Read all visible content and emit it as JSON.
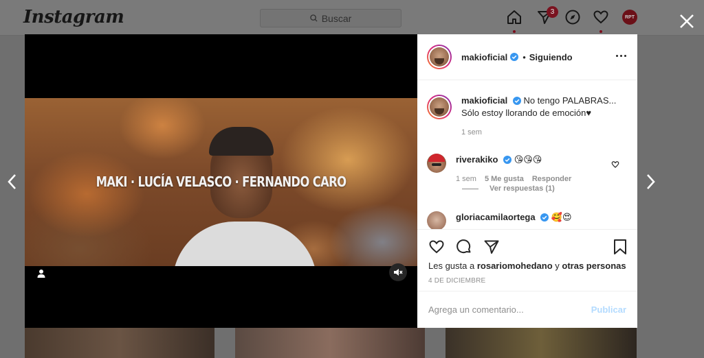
{
  "app": {
    "logo": "Instagram"
  },
  "search": {
    "placeholder": "Buscar"
  },
  "nav": {
    "notifications_badge": "3",
    "profile_avatar_text": "RPT"
  },
  "post": {
    "video_overlay_text": "MAKI · LUCÍA VELASCO · FERNANDO CARO",
    "author": {
      "username": "makioficial",
      "separator": "•",
      "follow_status": "Siguiendo"
    },
    "caption": {
      "username": "makioficial",
      "text": "No tengo PALABRAS... Sólo estoy llorando de emoción♥",
      "time": "1 sem"
    },
    "comments": [
      {
        "username": "riverakiko",
        "text": "😘😘😘",
        "time": "1 sem",
        "likes": "5 Me gusta",
        "reply": "Responder",
        "view_replies": "Ver respuestas (1)"
      },
      {
        "username": "gloriacamilaortega",
        "text": "🥰😍"
      }
    ],
    "likes_prefix": "Les gusta a",
    "likes_user": "rosariomohedano",
    "likes_middle": "y",
    "likes_suffix": "otras personas",
    "date": "4 DE DICIEMBRE",
    "comment_placeholder": "Agrega un comentario...",
    "publish": "Publicar"
  },
  "colors": {
    "accent": "#0095f6",
    "verified": "#3897f0",
    "publish_disabled": "#b3dbff"
  }
}
